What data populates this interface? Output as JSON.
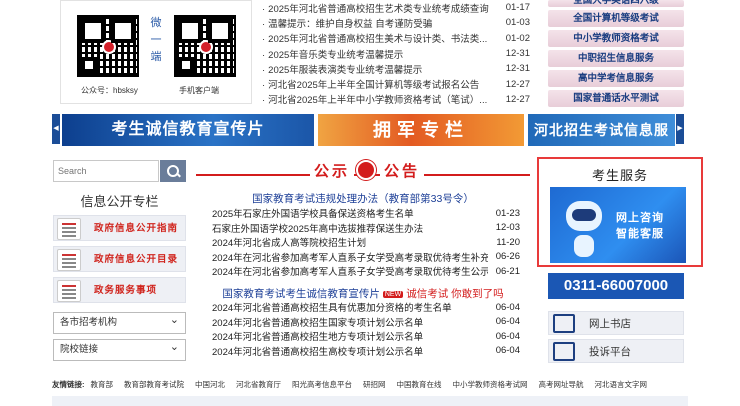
{
  "qr": {
    "vertical_text": "微一端",
    "caption_left": "公众号：hbsksy",
    "caption_right": "手机客户端"
  },
  "top_news": [
    {
      "title": "2025年河北省普通高校招生艺术类专业统考成绩查询",
      "date": "01-17"
    },
    {
      "title": "温馨提示：维护自身权益 自考谨防受骗",
      "date": "01-03"
    },
    {
      "title": "2025年河北省普通高校招生美术与设计类、书法类...",
      "date": "01-02"
    },
    {
      "title": "2025年音乐类专业统考温馨提示",
      "date": "12-31"
    },
    {
      "title": "2025年服装表演类专业统考温馨提示",
      "date": "12-31"
    },
    {
      "title": "河北省2025年上半年全国计算机等级考试报名公告",
      "date": "12-27"
    },
    {
      "title": "河北省2025年上半年中小学教师资格考试（笔试）...",
      "date": "12-27"
    }
  ],
  "right_menu": [
    "全国大学英语四六级",
    "全国计算机等级考试",
    "中小学教师资格考试",
    "中职招生信息服务",
    "高中学考信息服务",
    "国家普通话水平测试"
  ],
  "banners": {
    "left_arrow": "◀",
    "right_arrow": "▶",
    "b1": "考生诚信教育宣传片",
    "b2": "拥军专栏",
    "b3": "河北招生考试信息服务网"
  },
  "search": {
    "placeholder": "Search"
  },
  "left": {
    "title": "信息公开专栏",
    "buttons": [
      "政府信息公开指南",
      "政府信息公开目录",
      "政务服务事项"
    ],
    "select1": "各市招考机构",
    "select2": "院校链接"
  },
  "announce": {
    "h1": "公示",
    "h2": "公告",
    "sub1": "国家教育考试违规处理办法（教育部第33号令）",
    "list1": [
      {
        "title": "2025年石家庄外国语学校具备保送资格考生名单",
        "date": "01-23"
      },
      {
        "title": "石家庄外国语学校2025年高中选拔推荐保送生办法",
        "date": "12-03"
      },
      {
        "title": "2024年河北省成人高等院校招生计划",
        "date": "11-20"
      },
      {
        "title": "2024年在河北省参加高考军人直系子女学受高考录取优待考生补充...",
        "date": "06-26"
      },
      {
        "title": "2024年在河北省参加高考军人直系子女学受高考录取优待考生公示...",
        "date": "06-21"
      }
    ],
    "sub2_left": "国家教育考试考生诚信教育宣传片",
    "sub2_badge": "NEW",
    "sub2_right": "诚信考试 你敢到了吗",
    "list2": [
      {
        "title": "2024年河北省普通高校招生具有优惠加分资格的考生名单",
        "date": "06-04"
      },
      {
        "title": "2024年河北省普通高校招生国家专项计划公示名单",
        "date": "06-04"
      },
      {
        "title": "2024年河北省普通高校招生地方专项计划公示名单",
        "date": "06-04"
      },
      {
        "title": "2024年河北省普通高校招生高校专项计划公示名单",
        "date": "06-04"
      }
    ]
  },
  "service": {
    "title": "考生服务",
    "card_line1": "网上咨询",
    "card_line2": "智能客服",
    "phone": "0311-66007000",
    "btn1": "网上书店",
    "btn2": "投诉平台"
  },
  "friend_links": {
    "label": "友情链接:",
    "items": [
      "教育部",
      "教育部教育考试院",
      "中国河北",
      "河北省教育厅",
      "阳光高考信息平台",
      "研招网",
      "中国教育在线",
      "中小学教师资格考试网",
      "高考网址导航",
      "河北语言文字网"
    ]
  }
}
